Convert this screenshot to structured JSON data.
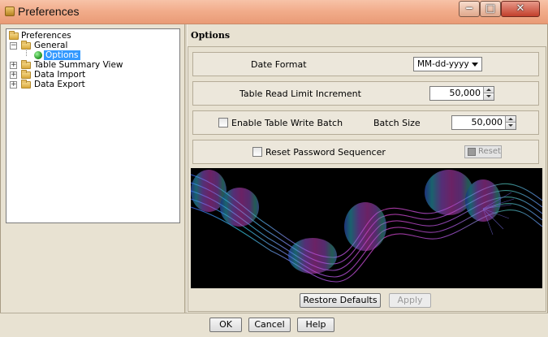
{
  "window": {
    "title": "Preferences",
    "minimize_glyph": "‒",
    "maximize_glyph": "□",
    "close_glyph": "✕"
  },
  "tree": {
    "root": "Preferences",
    "items": [
      {
        "label": "General",
        "expanded": true,
        "children": [
          {
            "label": "Options",
            "selected": true
          }
        ]
      },
      {
        "label": "Table Summary View",
        "expanded": false
      },
      {
        "label": "Data Import",
        "expanded": false
      },
      {
        "label": "Data Export",
        "expanded": false
      }
    ]
  },
  "options": {
    "header": "Options",
    "date_format": {
      "label": "Date Format",
      "value": "MM-dd-yyyy"
    },
    "table_read": {
      "label": "Table Read Limit Increment",
      "value": "50,000"
    },
    "write_batch": {
      "label": "Enable Table Write Batch",
      "checked": false,
      "batch_label": "Batch Size",
      "batch_value": "50,000"
    },
    "reset_password": {
      "label": "Reset Password Sequencer",
      "checked": false,
      "button": "Reset"
    },
    "restore_button": "Restore Defaults",
    "apply_button": "Apply"
  },
  "footer": {
    "ok": "OK",
    "cancel": "Cancel",
    "help": "Help"
  },
  "colors": {
    "titlebar": "#f2ad8c",
    "selection": "#3399ff",
    "panel": "#e8e2d2",
    "art_background": "#000000"
  }
}
